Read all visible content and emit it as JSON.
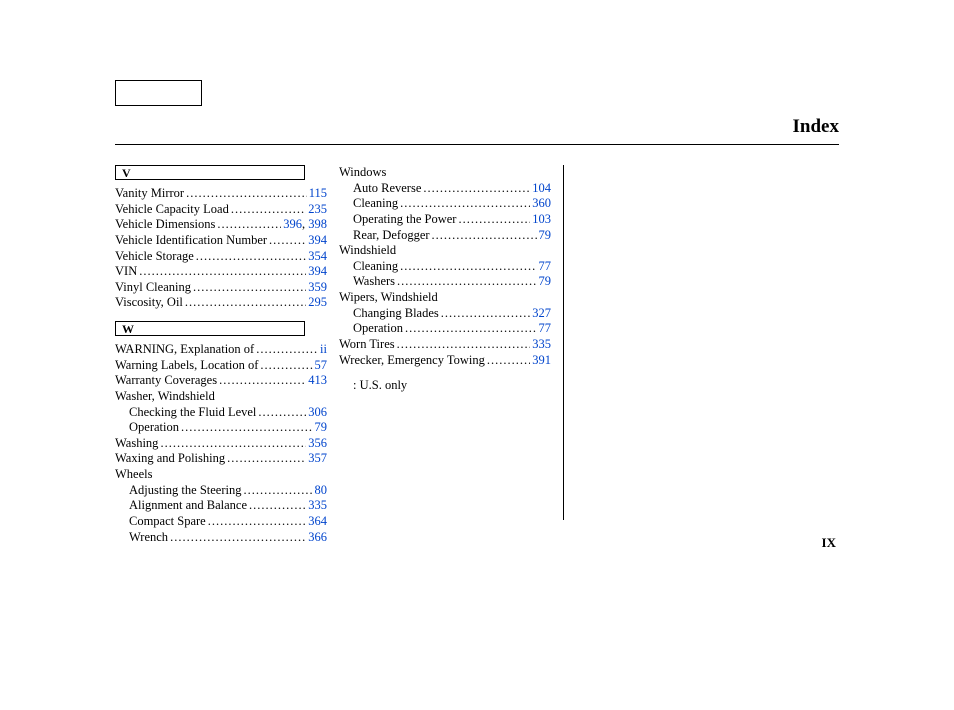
{
  "pageTitle": "Index",
  "pageNumber": "IX",
  "columns": [
    {
      "groups": [
        {
          "letter": "V",
          "entries": [
            {
              "label": "Vanity Mirror",
              "pages": [
                "115"
              ]
            },
            {
              "label": "Vehicle Capacity Load",
              "pages": [
                "235"
              ]
            },
            {
              "label": "Vehicle Dimensions",
              "pages": [
                "396",
                "398"
              ]
            },
            {
              "label": "Vehicle Identification Number",
              "pages": [
                "394"
              ]
            },
            {
              "label": "Vehicle Storage",
              "pages": [
                "354"
              ]
            },
            {
              "label": "VIN",
              "pages": [
                "394"
              ]
            },
            {
              "label": "Vinyl Cleaning",
              "pages": [
                "359"
              ]
            },
            {
              "label": "Viscosity, Oil",
              "pages": [
                "295"
              ]
            }
          ]
        },
        {
          "letter": "W",
          "entries": [
            {
              "label": "WARNING, Explanation of",
              "pages": [
                "ii"
              ]
            },
            {
              "label": "Warning Labels, Location of",
              "pages": [
                "57"
              ]
            },
            {
              "label": "Warranty Coverages  ",
              "pages": [
                "413"
              ]
            },
            {
              "label": "Washer, Windshield",
              "pages": []
            },
            {
              "label": "Checking the Fluid Level",
              "pages": [
                "306"
              ],
              "sub": true
            },
            {
              "label": "Operation",
              "pages": [
                "79"
              ],
              "sub": true
            },
            {
              "label": "Washing",
              "pages": [
                "356"
              ]
            },
            {
              "label": "Waxing and Polishing",
              "pages": [
                "357"
              ]
            },
            {
              "label": "Wheels",
              "pages": []
            },
            {
              "label": "Adjusting the Steering",
              "pages": [
                "80"
              ],
              "sub": true
            },
            {
              "label": "Alignment and Balance",
              "pages": [
                "335"
              ],
              "sub": true
            },
            {
              "label": "Compact Spare",
              "pages": [
                "364"
              ],
              "sub": true
            },
            {
              "label": "Wrench",
              "pages": [
                "366"
              ],
              "sub": true
            }
          ]
        }
      ]
    },
    {
      "groups": [
        {
          "entries": [
            {
              "label": "Windows",
              "pages": []
            },
            {
              "label": "Auto Reverse",
              "pages": [
                "104"
              ],
              "sub": true
            },
            {
              "label": "Cleaning",
              "pages": [
                "360"
              ],
              "sub": true
            },
            {
              "label": "Operating the Power",
              "pages": [
                "103"
              ],
              "sub": true
            },
            {
              "label": "Rear, Defogger",
              "pages": [
                "79"
              ],
              "sub": true
            },
            {
              "label": "Windshield",
              "pages": []
            },
            {
              "label": "Cleaning",
              "pages": [
                "77"
              ],
              "sub": true
            },
            {
              "label": "Washers",
              "pages": [
                "79"
              ],
              "sub": true
            },
            {
              "label": "Wipers, Windshield",
              "pages": []
            },
            {
              "label": "Changing Blades",
              "pages": [
                "327"
              ],
              "sub": true
            },
            {
              "label": "Operation",
              "pages": [
                "77"
              ],
              "sub": true
            },
            {
              "label": "Worn Tires",
              "pages": [
                "335"
              ]
            },
            {
              "label": "Wrecker, Emergency Towing",
              "pages": [
                "391"
              ]
            }
          ]
        }
      ],
      "note": ": U.S. only"
    }
  ]
}
